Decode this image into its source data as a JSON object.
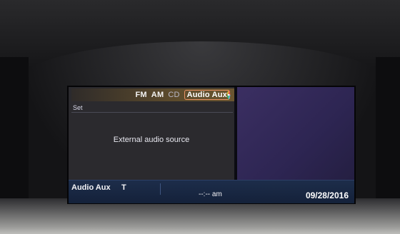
{
  "source_tabs": [
    {
      "label": "FM",
      "active": false
    },
    {
      "label": "AM",
      "active": false
    },
    {
      "label": "CD",
      "active": false
    },
    {
      "label": "Audio Aux",
      "active": true
    }
  ],
  "nav_icon": "navigation-compass-icon",
  "menu": {
    "set_label": "Set"
  },
  "main": {
    "message": "External audio source"
  },
  "status": {
    "source": "Audio Aux",
    "traffic_indicator": "T",
    "time": "--:-- am",
    "date": "09/28/2016"
  },
  "colors": {
    "active_tab_border": "#e79063",
    "status_bar": "#1d2d4a",
    "right_pane": "#3b2f62"
  }
}
